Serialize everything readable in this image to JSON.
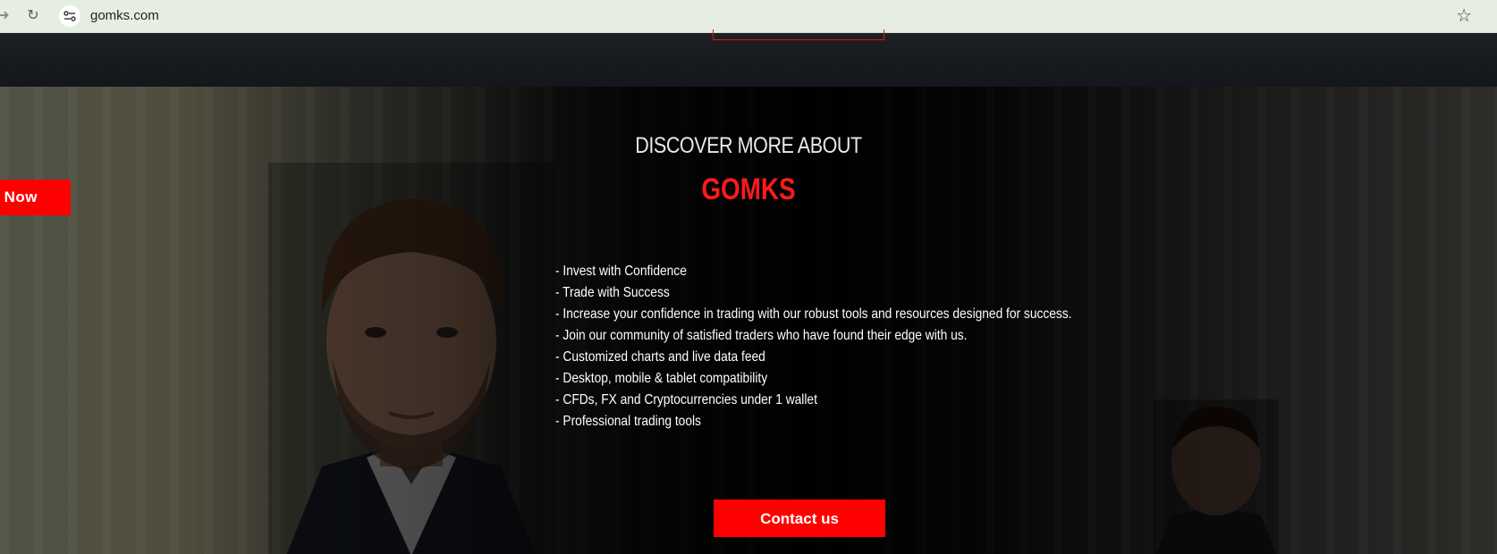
{
  "browser": {
    "url": "gomks.com",
    "icons": {
      "forward": "arrow-right-icon",
      "reload": "reload-icon",
      "site_info": "tune-icon",
      "bookmark": "star-icon"
    }
  },
  "hero": {
    "start_button_label": "rt Now",
    "heading": "DISCOVER MORE ABOUT",
    "brand": "GOMKS",
    "features": [
      "- Invest with Confidence",
      "- Trade with Success",
      "- Increase your confidence in trading with our robust tools and resources designed for success.",
      "- Join our community of satisfied traders who have found their edge with us.",
      "- Customized charts and live data feed",
      "- Desktop, mobile & tablet compatibility",
      "- CFDs, FX and Cryptocurrencies under 1 wallet",
      "- Professional trading tools"
    ],
    "contact_button_label": "Contact us"
  },
  "colors": {
    "accent": "#ff0000",
    "brand_text": "#ff1a1a",
    "chrome_bg": "#e6eee2"
  }
}
